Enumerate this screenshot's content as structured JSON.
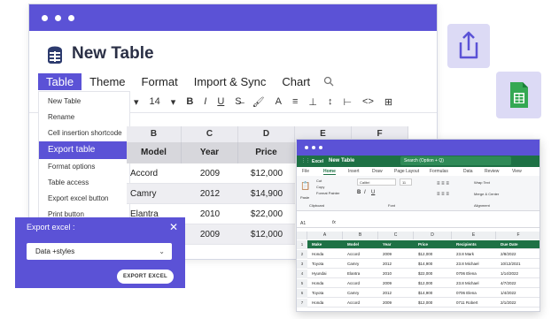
{
  "app": {
    "title": "New Table",
    "menu": [
      "Table",
      "Theme",
      "Format",
      "Import & Sync",
      "Chart"
    ],
    "active_menu": "Table",
    "toolbar": {
      "font_size": "14",
      "bold": "B",
      "italic": "I",
      "underline": "U",
      "strike": "S̶"
    },
    "dropdown": [
      "New Table",
      "Rename",
      "Cell insertion shortcode",
      "Export table",
      "Format options",
      "Table access",
      "Export excel button",
      "Print button"
    ],
    "active_dropdown": "Export table",
    "columns": [
      "B",
      "C",
      "D",
      "E",
      "F"
    ],
    "headers": [
      "Model",
      "Year",
      "Price"
    ],
    "rows": [
      [
        "Accord",
        "2009",
        "$12,000"
      ],
      [
        "Camry",
        "2012",
        "$14,900"
      ],
      [
        "Elantra",
        "2010",
        "$22,000"
      ],
      [
        "",
        "2009",
        "$12,000"
      ]
    ]
  },
  "export_panel": {
    "title": "Export excel :",
    "close": "✕",
    "select_value": "Data +styles",
    "button": "EXPORT EXCEL"
  },
  "excel": {
    "brand": "Excel",
    "title": "New Table",
    "search": "Search (Option + Q)",
    "ribbon_tabs": [
      "File",
      "Home",
      "Insert",
      "Draw",
      "Page Layout",
      "Formulas",
      "Data",
      "Review",
      "View"
    ],
    "ribbon": {
      "cut": "Cut",
      "copy": "Copy",
      "paste": "Paste",
      "format_painter": "Format Painter",
      "font": "Calibri",
      "font_size": "11",
      "wrap": "Wrap Text",
      "merge": "Merge & Center",
      "clipboard": "Clipboard",
      "font_group": "Font",
      "alignment": "Alignment"
    },
    "cell_ref": "A1",
    "columns": [
      "A",
      "B",
      "C",
      "D",
      "E",
      "F"
    ],
    "headers": [
      "Make",
      "Model",
      "Year",
      "Price",
      "Recipients",
      "Due Date"
    ],
    "rows": [
      [
        "Honda",
        "Accord",
        "2009",
        "$12,000",
        "23.8 Mark",
        "2/8/2022"
      ],
      [
        "Toyota",
        "Camry",
        "2012",
        "$14,900",
        "23.8 Michael",
        "10/12/2021"
      ],
      [
        "Hyundai",
        "Elantra",
        "2010",
        "$22,000",
        "0706 Elena",
        "1/14/2022"
      ],
      [
        "Honda",
        "Accord",
        "2009",
        "$12,000",
        "23.8 Michael",
        "4/7/2022"
      ],
      [
        "Toyota",
        "Camry",
        "2012",
        "$14,900",
        "0706 Elena",
        "1/4/2022"
      ],
      [
        "Honda",
        "Accord",
        "2009",
        "$12,000",
        "0711 Robert",
        "2/1/2022"
      ]
    ]
  },
  "colors": {
    "accent": "#5b52d6",
    "excel_green": "#1e7145",
    "sheets_green": "#34a853",
    "card_bg": "#dcdaf5"
  },
  "icons": [
    "logo-icon",
    "search-icon",
    "share-icon",
    "google-sheets-icon",
    "close-icon",
    "chevron-down-icon"
  ]
}
